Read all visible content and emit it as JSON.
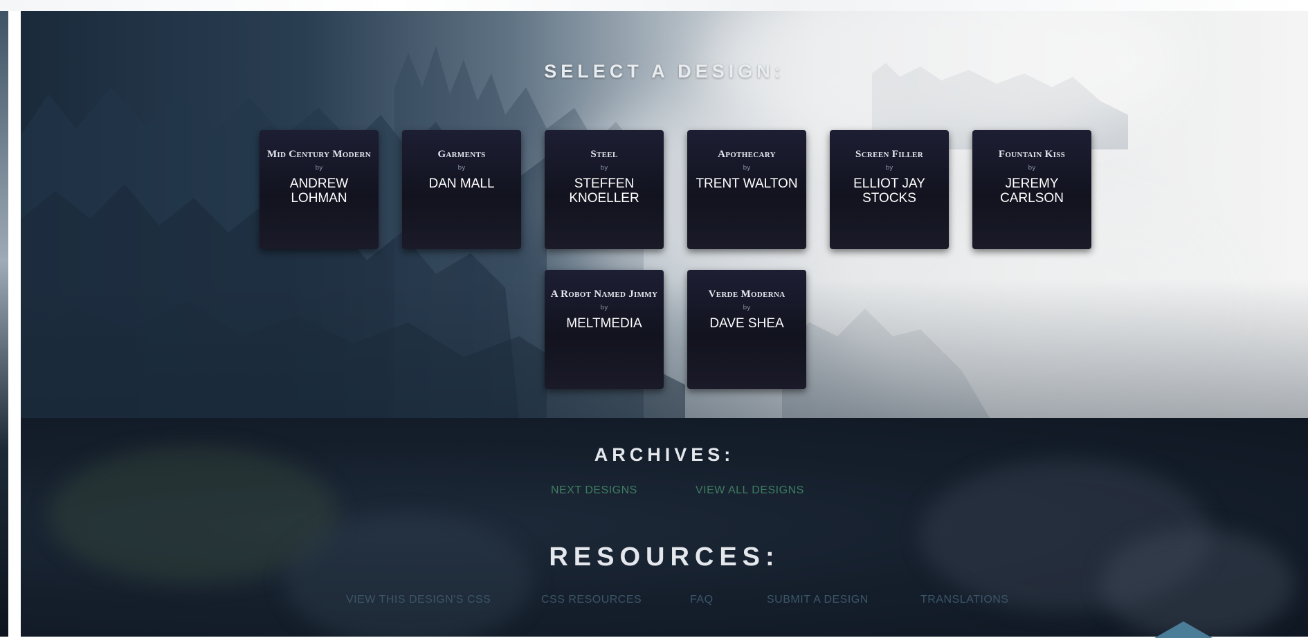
{
  "select": {
    "title": "SELECT A DESIGN:",
    "by_label": "by",
    "designs": [
      {
        "title": "Mid Century Modern",
        "author": "Andrew Lohman"
      },
      {
        "title": "Garments",
        "author": "Dan Mall"
      },
      {
        "title": "Steel",
        "author": "Steffen Knoeller"
      },
      {
        "title": "Apothecary",
        "author": "Trent Walton"
      },
      {
        "title": "Screen Filler",
        "author": "Elliot Jay Stocks"
      },
      {
        "title": "Fountain Kiss",
        "author": "Jeremy Carlson"
      },
      {
        "title": "A Robot Named Jimmy",
        "author": "Meltmedia"
      },
      {
        "title": "Verde Moderna",
        "author": "Dave Shea"
      }
    ]
  },
  "archives": {
    "title": "ARCHIVES:",
    "links": [
      "NEXT DESIGNS",
      "VIEW ALL DESIGNS"
    ]
  },
  "resources": {
    "title": "RESOURCES:",
    "links": [
      "VIEW THIS DESIGN'S CSS",
      "CSS RESOURCES",
      "FAQ",
      "SUBMIT A DESIGN",
      "TRANSLATIONS"
    ]
  },
  "icons": {
    "back_to_top": "arrow-up-icon"
  },
  "colors": {
    "card_bg": "#15162a",
    "archive_link": "#3e7d60",
    "resource_link": "#3d5668",
    "back_to_top": "#4a7d98"
  }
}
